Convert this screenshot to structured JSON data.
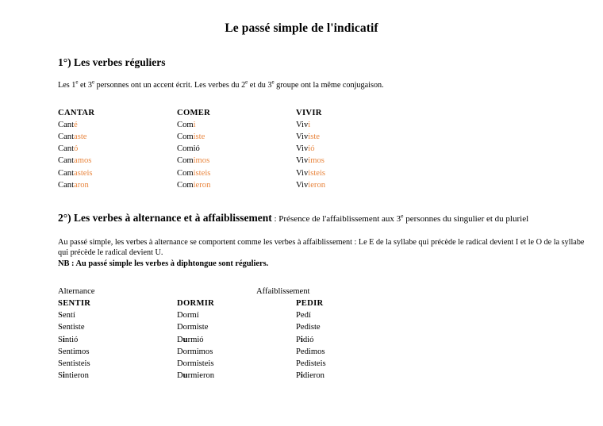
{
  "document": {
    "title": "Le passé simple de l'indicatif"
  },
  "sections": [
    {
      "heading": "1°) Les verbes réguliers",
      "heading_tail": "",
      "intro_prefix": "Les 1",
      "intro_sup1": "e",
      "intro_mid1": " et 3",
      "intro_sup2": "e",
      "intro_mid2": " personnes ont un accent écrit. Les verbes du 2",
      "intro_sup3": "e",
      "intro_mid3": " et du 3",
      "intro_sup4": "e",
      "intro_end": " groupe ont la même conjugaison."
    },
    {
      "heading": "2°) Les verbes à alternance et à affaiblissement",
      "tail_prefix": " : Présence de l'affaiblissement aux 3",
      "tail_sup": "e",
      "tail_suffix": " personnes du singulier et du pluriel",
      "para_line1": "Au passé simple, les verbes à alternance se comportent comme les verbes à affaiblissement : Le E de la syllabe qui précède le radical devient I et le O",
      "para_line2": "de la syllabe qui précède le radical devient U.",
      "nb": "NB : Au passé simple les verbes à diphtongue sont réguliers."
    }
  ],
  "colors": {
    "ending_orange": "#E8843C",
    "text_black": "#000000",
    "page_background": "#FFFFFF"
  },
  "regular_verbs": {
    "headers": [
      "CANTAR",
      "COMER",
      "VIVIR"
    ],
    "rows": [
      [
        {
          "stem": "Cant",
          "ending": "é"
        },
        {
          "stem": "Com",
          "ending": "i"
        },
        {
          "stem": "Viv",
          "ending": "i"
        }
      ],
      [
        {
          "stem": "Cant",
          "ending": "aste"
        },
        {
          "stem": "Com",
          "ending": "iste"
        },
        {
          "stem": "Viv",
          "ending": "iste"
        }
      ],
      [
        {
          "stem": "Cant",
          "ending": "ó"
        },
        {
          "stem": "Comió",
          "ending": ""
        },
        {
          "stem": "Viv",
          "ending": "ió"
        }
      ],
      [
        {
          "stem": "Cant",
          "ending": "amos"
        },
        {
          "stem": "Com",
          "ending": "imos"
        },
        {
          "stem": "Viv",
          "ending": "imos"
        }
      ],
      [
        {
          "stem": "Cant",
          "ending": "asteis"
        },
        {
          "stem": "Com",
          "ending": "isteis"
        },
        {
          "stem": "Viv",
          "ending": "isteis"
        }
      ],
      [
        {
          "stem": "Cant",
          "ending": "aron"
        },
        {
          "stem": "Com",
          "ending": "ieron"
        },
        {
          "stem": "Viv",
          "ending": "ieron"
        }
      ]
    ]
  },
  "alternance_table": {
    "group_labels": [
      "Alternance",
      "Affaiblissement"
    ],
    "headers": [
      "SENTIR",
      "DORMIR",
      "PEDIR"
    ],
    "rows": [
      [
        {
          "pre": "Sent",
          "bold": "",
          "post": "í"
        },
        {
          "pre": "Dorm",
          "bold": "",
          "post": "í"
        },
        {
          "pre": "Ped",
          "bold": "",
          "post": "í"
        }
      ],
      [
        {
          "pre": "Sent",
          "bold": "",
          "post": "iste"
        },
        {
          "pre": "Dorm",
          "bold": "",
          "post": "iste"
        },
        {
          "pre": "Ped",
          "bold": "",
          "post": "iste"
        }
      ],
      [
        {
          "pre": "S",
          "bold": "i",
          "post": "ntió"
        },
        {
          "pre": "D",
          "bold": "u",
          "post": "rmió"
        },
        {
          "pre": "P",
          "bold": "i",
          "post": "dió"
        }
      ],
      [
        {
          "pre": "Sent",
          "bold": "",
          "post": "imos"
        },
        {
          "pre": "Dorm",
          "bold": "",
          "post": "imos"
        },
        {
          "pre": "Ped",
          "bold": "",
          "post": "imos"
        }
      ],
      [
        {
          "pre": "Sent",
          "bold": "",
          "post": "isteis"
        },
        {
          "pre": "Dorm",
          "bold": "",
          "post": "isteis"
        },
        {
          "pre": "Ped",
          "bold": "",
          "post": "isteis"
        }
      ],
      [
        {
          "pre": "S",
          "bold": "i",
          "post": "ntieron"
        },
        {
          "pre": "D",
          "bold": "u",
          "post": "rmieron"
        },
        {
          "pre": "P",
          "bold": "i",
          "post": "dieron"
        }
      ]
    ]
  }
}
